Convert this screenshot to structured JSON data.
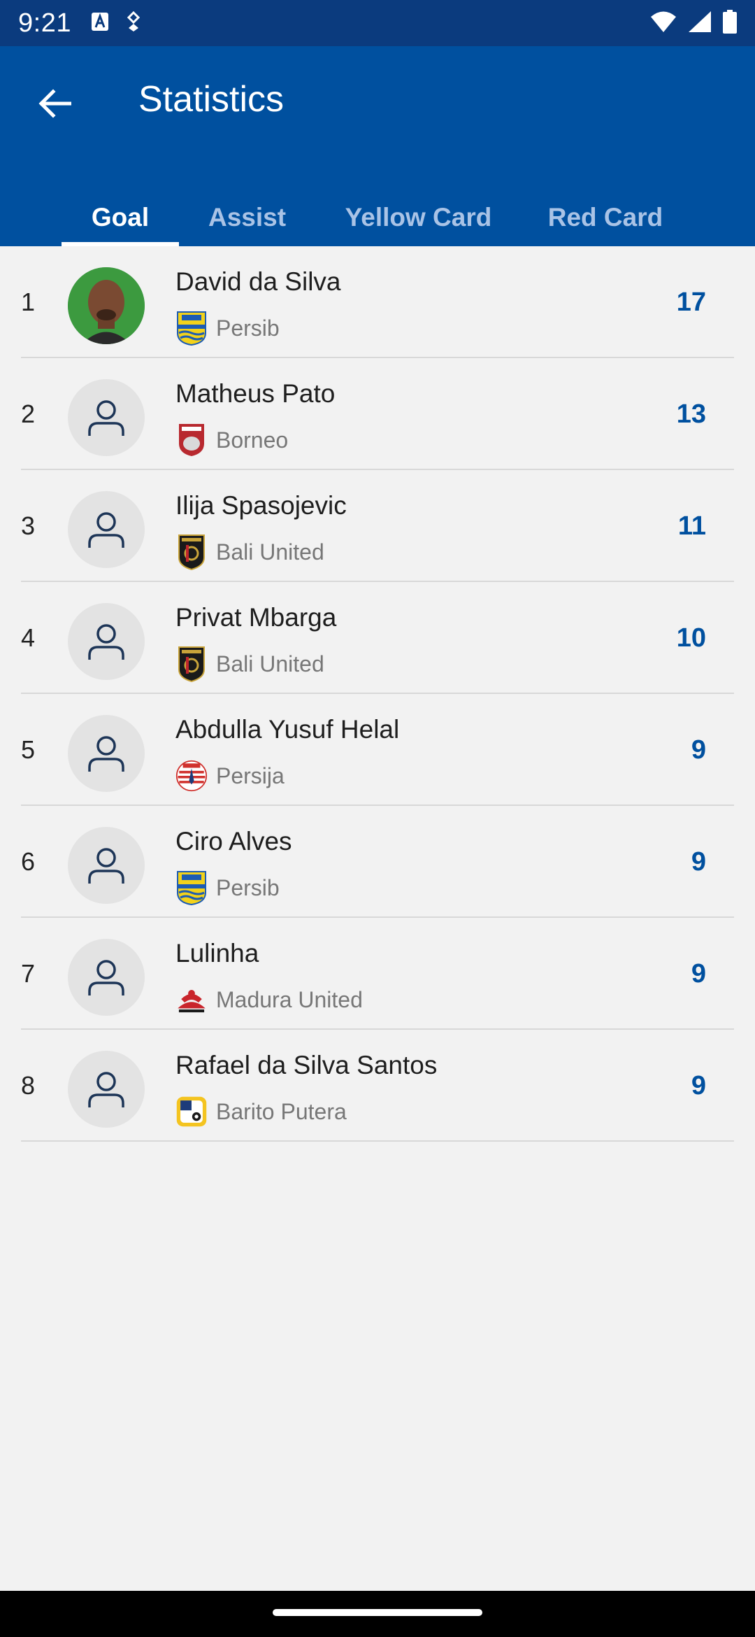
{
  "status_bar": {
    "time": "9:21",
    "left_icons": [
      "text-a-icon",
      "location-icon"
    ],
    "right_icons": [
      "wifi-icon",
      "signal-icon",
      "battery-icon"
    ]
  },
  "header": {
    "title": "Statistics",
    "back_icon": "arrow-left-icon"
  },
  "tabs": [
    {
      "label": "Goal",
      "active": true
    },
    {
      "label": "Assist",
      "active": false
    },
    {
      "label": "Yellow Card",
      "active": false
    },
    {
      "label": "Red Card",
      "active": false
    }
  ],
  "players": [
    {
      "rank": "1",
      "name": "David da Silva",
      "team": "Persib",
      "value": "17"
    },
    {
      "rank": "2",
      "name": "Matheus Pato",
      "team": "Borneo",
      "value": "13"
    },
    {
      "rank": "3",
      "name": "Ilija Spasojevic",
      "team": "Bali United",
      "value": "11"
    },
    {
      "rank": "4",
      "name": "Privat Mbarga",
      "team": "Bali United",
      "value": "10"
    },
    {
      "rank": "5",
      "name": "Abdulla Yusuf Helal",
      "team": "Persija",
      "value": "9"
    },
    {
      "rank": "6",
      "name": "Ciro Alves",
      "team": "Persib",
      "value": "9"
    },
    {
      "rank": "7",
      "name": "Lulinha",
      "team": "Madura United",
      "value": "9"
    },
    {
      "rank": "8",
      "name": "Rafael da Silva Santos",
      "team": "Barito Putera",
      "value": "9"
    }
  ],
  "colors": {
    "primary": "#00509f",
    "status_bar": "#0b3b7e",
    "background": "#f2f2f2"
  }
}
